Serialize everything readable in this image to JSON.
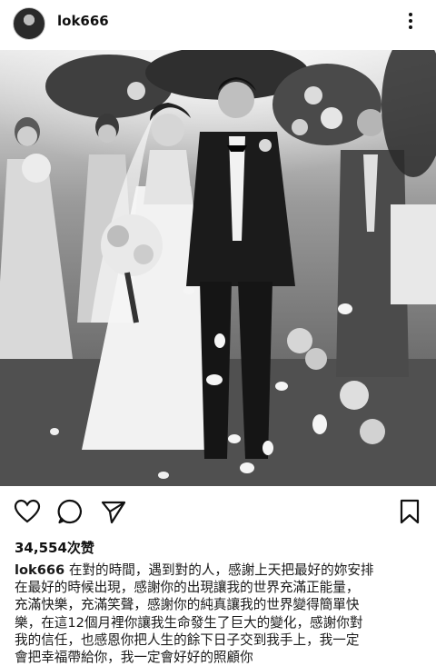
{
  "post": {
    "username": "lok666",
    "likes": "34,554次赞",
    "caption_user": "lok666",
    "caption_lines": [
      "在對的時間，遇到對的人，感謝上天把最好的妳安排",
      "在最好的時候出現，感謝你的出現讓我的世界充滿正能量，",
      "充滿快樂，充滿笑聲，感謝你的純真讓我的世界變得簡單快",
      "樂，在這12個月裡你讓我生命發生了巨大的變化，感謝你對",
      "我的信任，也感恩你把人生的餘下日子交到我手上，我一定",
      "會把幸福帶給你，我一定會好好的照顧你"
    ]
  },
  "icons": {
    "avatar": "avatar-photo",
    "more": "more-vertical-icon",
    "like": "heart-icon",
    "comment": "comment-icon",
    "share": "share-icon",
    "save": "bookmark-icon"
  },
  "photo": {
    "subject": "black-and-white wedding photo of bride and groom walking down aisle with bridesmaids and guests, petals falling"
  }
}
